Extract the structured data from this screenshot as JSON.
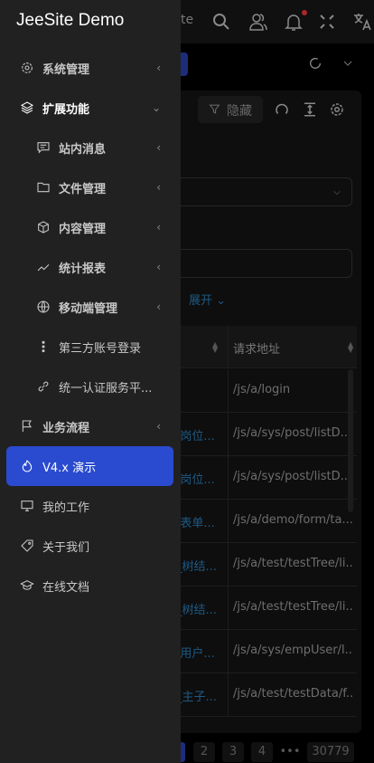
{
  "header": {
    "partial_title": "te"
  },
  "toolbar": {
    "hide_label": "隐藏"
  },
  "form": {
    "expand_label": "展开"
  },
  "table": {
    "header": "请求地址",
    "rows": [
      {
        "c1": "",
        "c2": "/js/a/login"
      },
      {
        "c1": "/岗位...",
        "c2": "/js/a/sys/post/listD..."
      },
      {
        "c1": "/岗位...",
        "c2": "/js/a/sys/post/listD..."
      },
      {
        "c1": "/表单...",
        "c2": "/js/a/demo/form/ta..."
      },
      {
        "c1": "_树结...",
        "c2": "/js/a/test/testTree/li..."
      },
      {
        "c1": "_树结...",
        "c2": "/js/a/test/testTree/li..."
      },
      {
        "c1": "/用户...",
        "c2": "/js/a/sys/empUser/l..."
      },
      {
        "c1": "_主子...",
        "c2": "/js/a/test/testData/f..."
      }
    ]
  },
  "pagination": {
    "pages": [
      "2",
      "3",
      "4",
      "•••",
      "30779"
    ]
  },
  "sidebar": {
    "logo": "JeeSite Demo",
    "items": [
      {
        "label": "系统管理"
      },
      {
        "label": "扩展功能"
      },
      {
        "label": "站内消息"
      },
      {
        "label": "文件管理"
      },
      {
        "label": "内容管理"
      },
      {
        "label": "统计报表"
      },
      {
        "label": "移动端管理"
      },
      {
        "label": "第三方账号登录"
      },
      {
        "label": "统一认证服务平..."
      },
      {
        "label": "业务流程"
      },
      {
        "label": "V4.x 演示"
      },
      {
        "label": "我的工作"
      },
      {
        "label": "关于我们"
      },
      {
        "label": "在线文档"
      }
    ]
  },
  "colors": {
    "accent": "#2a4bd0",
    "sidebar": "#212121",
    "link": "#1e5a85"
  }
}
